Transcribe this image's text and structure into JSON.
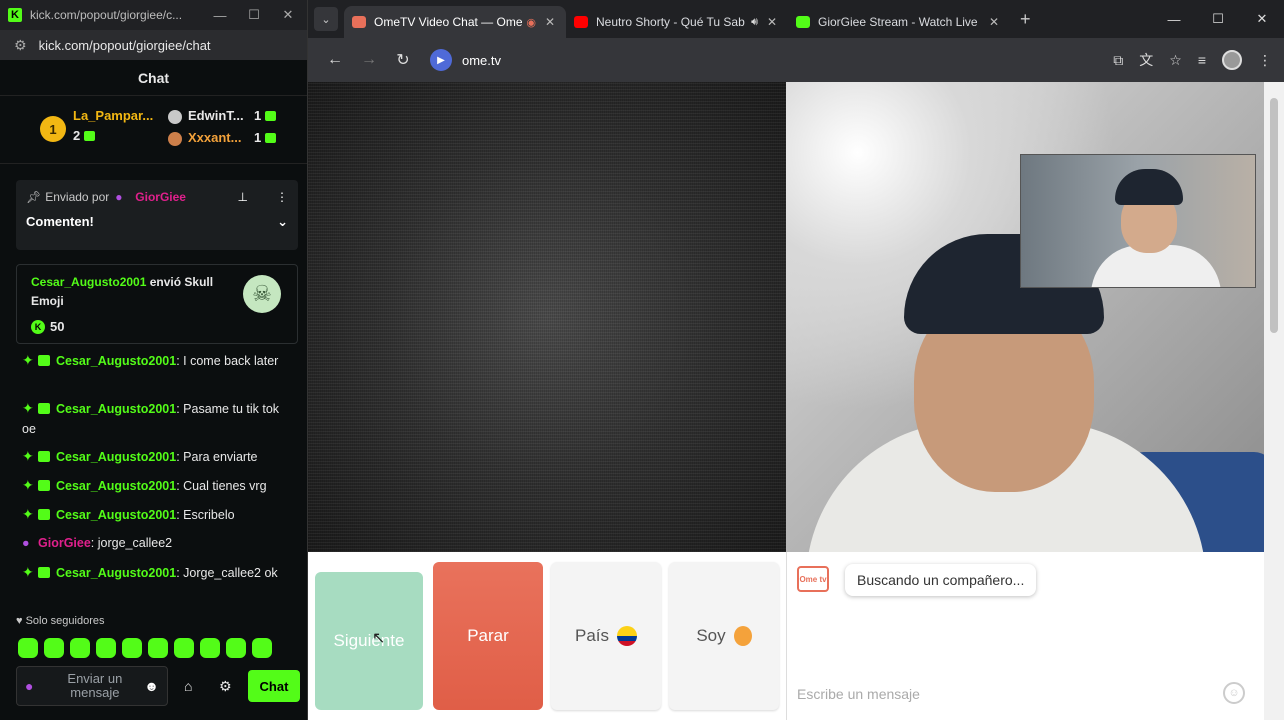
{
  "kick": {
    "window_title": "kick.com/popout/giorgiee/c...",
    "url": "kick.com/popout/giorgiee/chat",
    "chat_title": "Chat",
    "leaderboard": [
      {
        "rank": "1",
        "name": "La_Pampar...",
        "count": "2"
      },
      {
        "rank": "",
        "name": "EdwinT...",
        "count": "1"
      },
      {
        "rank": "",
        "name": "Xxxant...",
        "count": "1"
      }
    ],
    "pinned": {
      "sent_by_label": "Enviado por",
      "sender": "GiorGiee",
      "message": "Comenten!"
    },
    "gift": {
      "user": "Cesar_Augusto2001",
      "action": "envió Skull Emoji",
      "amount": "50"
    },
    "messages": [
      {
        "user": "Cesar_Augusto2001",
        "text": ": I come back later"
      },
      {
        "user": "Cesar_Augusto2001",
        "text": ": Pasame tu tik tok oe"
      },
      {
        "user": "Cesar_Augusto2001",
        "text": ": Para enviarte"
      },
      {
        "user": "Cesar_Augusto2001",
        "text": ": Cual tienes vrg"
      },
      {
        "user": "Cesar_Augusto2001",
        "text": ": Escribelo"
      },
      {
        "user": "GiorGiee",
        "text": ": jorge_callee2"
      },
      {
        "user": "Cesar_Augusto2001",
        "text": ": Jorge_callee2 ok"
      }
    ],
    "followers_only": "Solo seguidores",
    "input_placeholder": "Enviar un mensaje",
    "send_label": "Chat"
  },
  "browser": {
    "tabs": [
      {
        "title": "OmeTV Video Chat — Ome",
        "active": true
      },
      {
        "title": "Neutro Shorty - Qué Tu Sab",
        "active": false
      },
      {
        "title": "GiorGiee Stream - Watch Live o",
        "active": false
      }
    ],
    "url": "ome.tv"
  },
  "ometv": {
    "next_label": "Siguiente",
    "stop_label": "Parar",
    "country_label": "País",
    "gender_label": "Soy",
    "status_message": "Buscando un compañero...",
    "logo_text": "Ome tv",
    "input_placeholder": "Escribe un mensaje"
  },
  "colors": {
    "kick_green": "#53fc18",
    "streamer_pink": "#e0208c",
    "stop_red": "#e8705a",
    "next_green": "#a7dcc1"
  }
}
